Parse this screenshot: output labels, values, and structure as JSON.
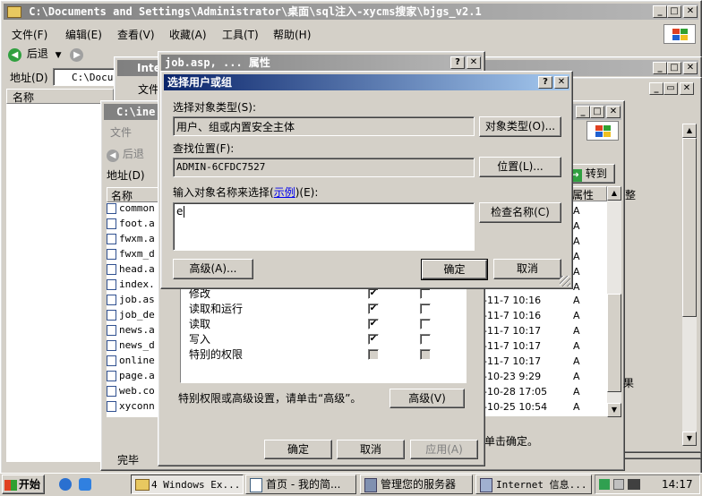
{
  "explorer_main": {
    "title": "C:\\Documents and Settings\\Administrator\\桌面\\sql注入-xycms搜家\\bjgs_v2.1",
    "menu": [
      "文件(F)",
      "编辑(E)",
      "查看(V)",
      "收藏(A)",
      "工具(T)",
      "帮助(H)"
    ],
    "back_label": "后退",
    "address_label": "地址(D)",
    "address_value": "C:\\Docum",
    "column_name": "名称"
  },
  "ie_window": {
    "title": "Inte",
    "menu_file": "文件"
  },
  "explorer_inner": {
    "title": "C:\\ine",
    "menu_file": "文件",
    "back_label": "后退",
    "address_label": "地址(D)",
    "column_name": "名称",
    "files": [
      "common",
      "foot.a",
      "fwxm.a",
      "fwxm_d",
      "head.a",
      "index.",
      "job.as",
      "job_de",
      "news.a",
      "news_d",
      "online",
      "page.a",
      "web.co",
      "xyconn"
    ],
    "status": "完毕"
  },
  "right_explorer": {
    "goto_label": "转到",
    "attr_header": "属性",
    "side_text1": "整",
    "side_text2": "果",
    "rows": [
      {
        "date": "-11-7 10:16",
        "attr": "A"
      },
      {
        "date": "-11-7 10:16",
        "attr": "A"
      },
      {
        "date": "-11-7 10:17",
        "attr": "A"
      },
      {
        "date": "-11-7 10:17",
        "attr": "A"
      },
      {
        "date": "-11-7 10:17",
        "attr": "A"
      },
      {
        "date": "-10-23 9:29",
        "attr": "A"
      },
      {
        "date": "-10-28 17:05",
        "attr": "A"
      },
      {
        "date": "-10-25 10:54",
        "attr": "A"
      }
    ],
    "attr_col_top": [
      "A",
      "A",
      "A",
      "A",
      "A",
      "A"
    ],
    "bottom_text": "单击确定。"
  },
  "properties": {
    "title": "job.asp, ...  属性",
    "permissions": [
      {
        "name": "修改",
        "allow": true,
        "deny": false,
        "disabled": false
      },
      {
        "name": "读取和运行",
        "allow": true,
        "deny": false,
        "disabled": false
      },
      {
        "name": "读取",
        "allow": true,
        "deny": false,
        "disabled": false
      },
      {
        "name": "写入",
        "allow": true,
        "deny": false,
        "disabled": false
      },
      {
        "name": "特别的权限",
        "allow": false,
        "deny": false,
        "disabled": true
      }
    ],
    "special_text": "特别权限或高级设置，请单击“高级”。",
    "advanced_button": "高级(V)",
    "ok": "确定",
    "cancel": "取消",
    "apply": "应用(A)"
  },
  "select_dialog": {
    "title": "选择用户或组",
    "object_type_label": "选择对象类型(S):",
    "object_type_value": "用户、组或内置安全主体",
    "object_type_button": "对象类型(O)...",
    "location_label": "查找位置(F):",
    "location_value": "ADMIN-6CFDC7527",
    "location_button": "位置(L)...",
    "enter_label_pre": "输入对象名称来选择(",
    "enter_label_link": "示例",
    "enter_label_post": ")(E):",
    "entry_value": "e",
    "check_names_button": "检查名称(C)",
    "advanced_button": "高级(A)...",
    "ok": "确定",
    "cancel": "取消"
  },
  "taskbar": {
    "start": "开始",
    "tasks": [
      "4 Windows Ex...",
      "首页 - 我的简...",
      "管理您的服务器",
      "Internet 信息..."
    ],
    "clock": "14:17"
  }
}
